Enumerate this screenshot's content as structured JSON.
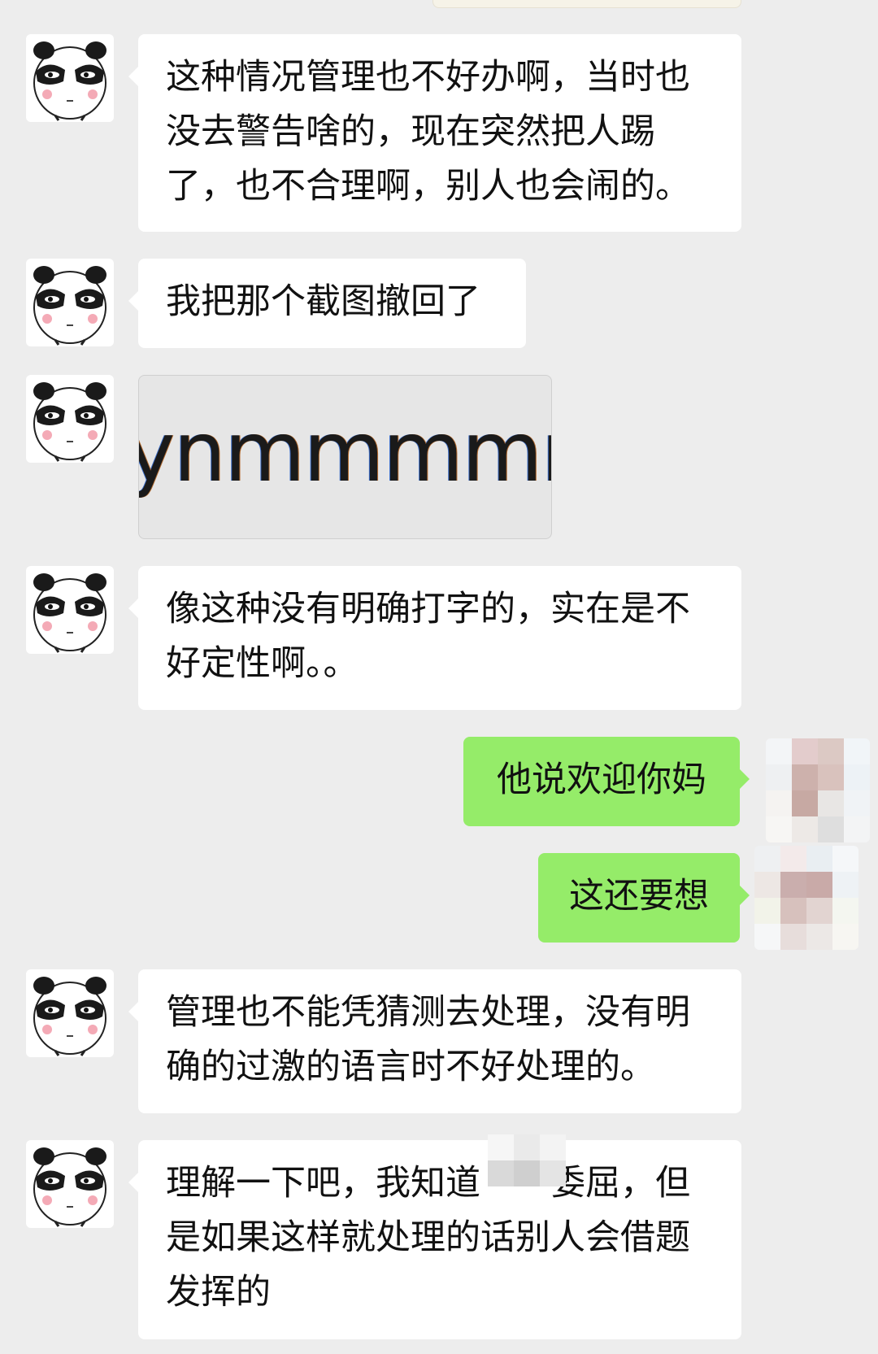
{
  "messages": [
    {
      "id": "m1",
      "side": "in",
      "text": "这种情况管理也不好办啊，当时也没去警告啥的，现在突然把人踢了，也不合理啊，别人也会闹的。"
    },
    {
      "id": "m2",
      "side": "in",
      "text": "我把那个截图撤回了"
    },
    {
      "id": "m3",
      "side": "in",
      "type": "image",
      "image_text": "ynmmmmm"
    },
    {
      "id": "m4",
      "side": "in",
      "text": "像这种没有明确打字的，实在是不好定性啊。。"
    },
    {
      "id": "m5",
      "side": "out",
      "text": "他说欢迎你妈"
    },
    {
      "id": "m6",
      "side": "out",
      "text": "这还要想"
    },
    {
      "id": "m7",
      "side": "in",
      "text": "管理也不能凭猜测去处理，没有明确的过激的语言时不好处理的。"
    },
    {
      "id": "m8",
      "side": "in",
      "text_a": "理解一下吧，我知道",
      "text_b": "委屈，但是如果这样就处理的话别人会借题发挥的"
    }
  ],
  "colors": {
    "background": "#ededed",
    "incoming_bubble": "#ffffff",
    "outgoing_bubble": "#95ec69"
  },
  "icons": {
    "contact_avatar": "panda-avatar-icon",
    "own_avatar": "pixelated-avatar-icon"
  }
}
